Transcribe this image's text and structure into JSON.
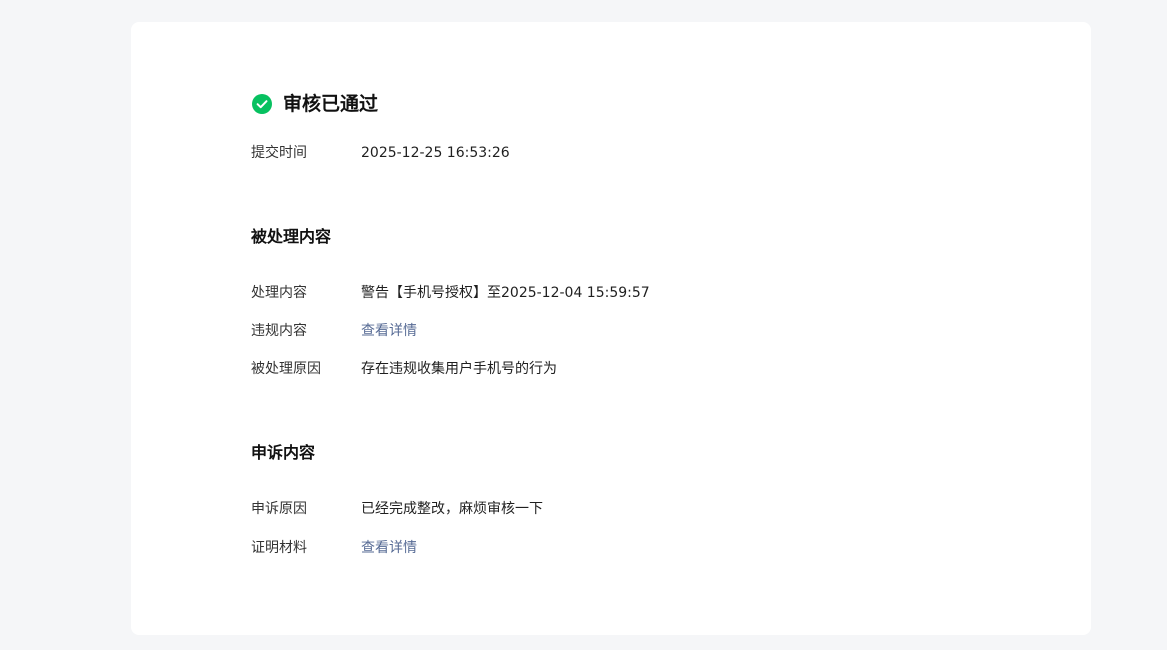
{
  "status": {
    "icon": "check-circle-icon",
    "color": "#07c160",
    "title": "审核已通过"
  },
  "submit": {
    "label": "提交时间",
    "value": "2025-12-25 16:53:26"
  },
  "processed_section": {
    "title": "被处理内容",
    "rows": [
      {
        "label": "处理内容",
        "value": "警告【手机号授权】至2025-12-04 15:59:57"
      },
      {
        "label": "违规内容",
        "value": "查看详情"
      },
      {
        "label": "被处理原因",
        "value": "存在违规收集用户手机号的行为"
      }
    ]
  },
  "appeal_section": {
    "title": "申诉内容",
    "rows": [
      {
        "label": "申诉原因",
        "value": "已经完成整改，麻烦审核一下"
      },
      {
        "label": "证明材料",
        "value": "查看详情"
      }
    ]
  },
  "colors": {
    "link": "#576b95",
    "background": "#f5f6f8",
    "card": "#ffffff"
  }
}
